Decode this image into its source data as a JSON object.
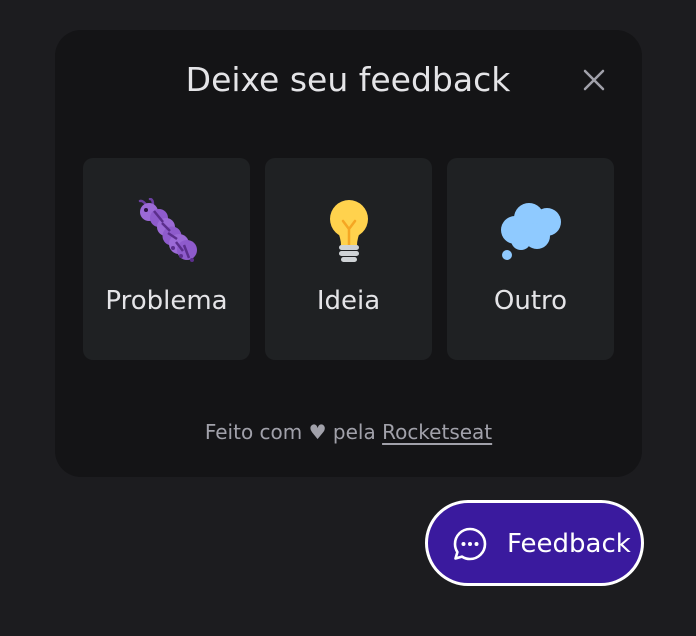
{
  "widget": {
    "title": "Deixe seu feedback",
    "close_icon": "close-icon"
  },
  "options": [
    {
      "label": "Problema",
      "icon": "bug-icon"
    },
    {
      "label": "Ideia",
      "icon": "lightbulb-icon"
    },
    {
      "label": "Outro",
      "icon": "thought-bubble-icon"
    }
  ],
  "footer": {
    "prefix": "Feito com ♥ pela",
    "link": "Rocketseat"
  },
  "fab": {
    "label": "Feedback",
    "icon": "chat-bubble-icon"
  },
  "colors": {
    "background": "#1c1c1f",
    "panel": "#141416",
    "card": "#1f2123",
    "brand": "#3a1a9e",
    "text": "#e4e4e7",
    "muted": "#a1a1aa"
  }
}
